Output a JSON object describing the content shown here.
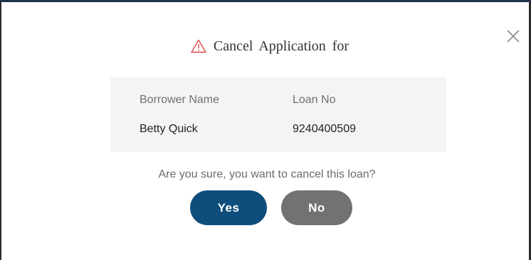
{
  "dialog": {
    "title": "Cancel Application for",
    "close_icon": "close-icon",
    "warning_icon": "warning-triangle-icon",
    "warning_color": "#e04a4a",
    "details": {
      "borrower_label": "Borrower Name",
      "loan_label": "Loan No",
      "borrower_value": "Betty Quick",
      "loan_value": "9240400509"
    },
    "question": "Are you sure, you want to cancel this loan?",
    "yes_label": "Yes",
    "no_label": "No",
    "yes_color": "#0f4e7c",
    "no_color": "#727272"
  }
}
